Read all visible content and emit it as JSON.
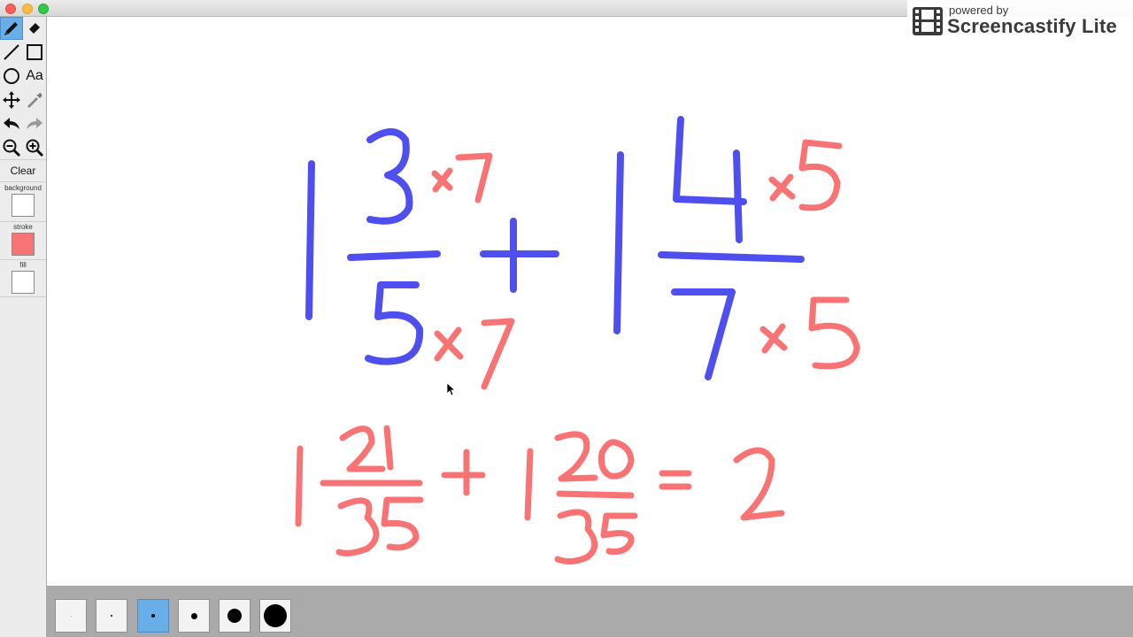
{
  "toolbar": {
    "tools": [
      {
        "name": "pencil",
        "icon": "pencil-icon",
        "active": true
      },
      {
        "name": "eraser",
        "icon": "eraser-icon"
      },
      {
        "name": "line",
        "icon": "line-icon"
      },
      {
        "name": "rectangle",
        "icon": "rectangle-icon"
      },
      {
        "name": "ellipse",
        "icon": "circle-icon"
      },
      {
        "name": "text",
        "icon": "text-icon",
        "label": "Aa"
      },
      {
        "name": "move",
        "icon": "move-icon"
      },
      {
        "name": "eyedropper",
        "icon": "eyedropper-icon"
      },
      {
        "name": "undo",
        "icon": "undo-icon"
      },
      {
        "name": "redo",
        "icon": "redo-icon"
      },
      {
        "name": "zoom-out",
        "icon": "zoom-out-icon"
      },
      {
        "name": "zoom-in",
        "icon": "zoom-in-icon"
      }
    ],
    "clear_label": "Clear",
    "background_label": "background",
    "background_color": "#ffffff",
    "stroke_label": "stroke",
    "stroke_color": "#f87474",
    "fill_label": "fill",
    "fill_color": "#ffffff"
  },
  "brush_sizes": {
    "options": [
      "xs",
      "s",
      "m",
      "l",
      "xl",
      "xxl"
    ],
    "selected": "m"
  },
  "watermark": {
    "powered_by": "powered by",
    "brand": "Screencastify Lite"
  },
  "colors": {
    "blue_ink": "#4f4ff0",
    "red_ink": "#f87474",
    "active_tool": "#6aaee8"
  }
}
